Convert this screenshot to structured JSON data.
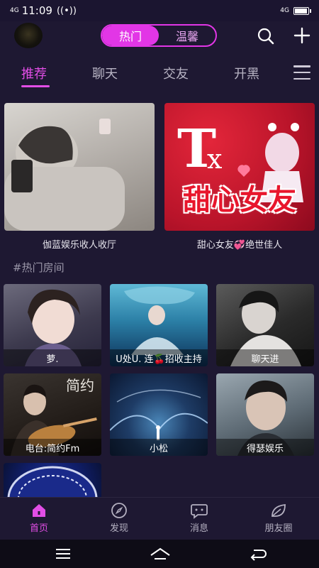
{
  "status": {
    "signal_left": "4G",
    "time": "11:09",
    "signal_right": "4G"
  },
  "header": {
    "seg_hot": "热门",
    "seg_warm": "温馨"
  },
  "tabs": [
    "推荐",
    "聊天",
    "交友",
    "开黑"
  ],
  "featured": [
    {
      "caption": "伽蓝娱乐收人收厅"
    },
    {
      "caption": "甜心女友💞绝世佳人",
      "poster_text": "甜心女友"
    }
  ],
  "section_title": "#热门房间",
  "rooms": [
    {
      "label": "萝."
    },
    {
      "label": "U处U. 连🍒招收主持"
    },
    {
      "label": "聊天进"
    },
    {
      "label": "电台:简约Fm",
      "poster_text": "简约"
    },
    {
      "label": "小松"
    },
    {
      "label": "得瑟娱乐"
    },
    {
      "label": ""
    }
  ],
  "nav": [
    {
      "label": "首页",
      "icon": "home-icon"
    },
    {
      "label": "发现",
      "icon": "compass-icon"
    },
    {
      "label": "消息",
      "icon": "chat-icon"
    },
    {
      "label": "朋友圈",
      "icon": "leaf-icon"
    }
  ],
  "colors": {
    "accent": "#e236e6",
    "background": "#1e1832"
  }
}
